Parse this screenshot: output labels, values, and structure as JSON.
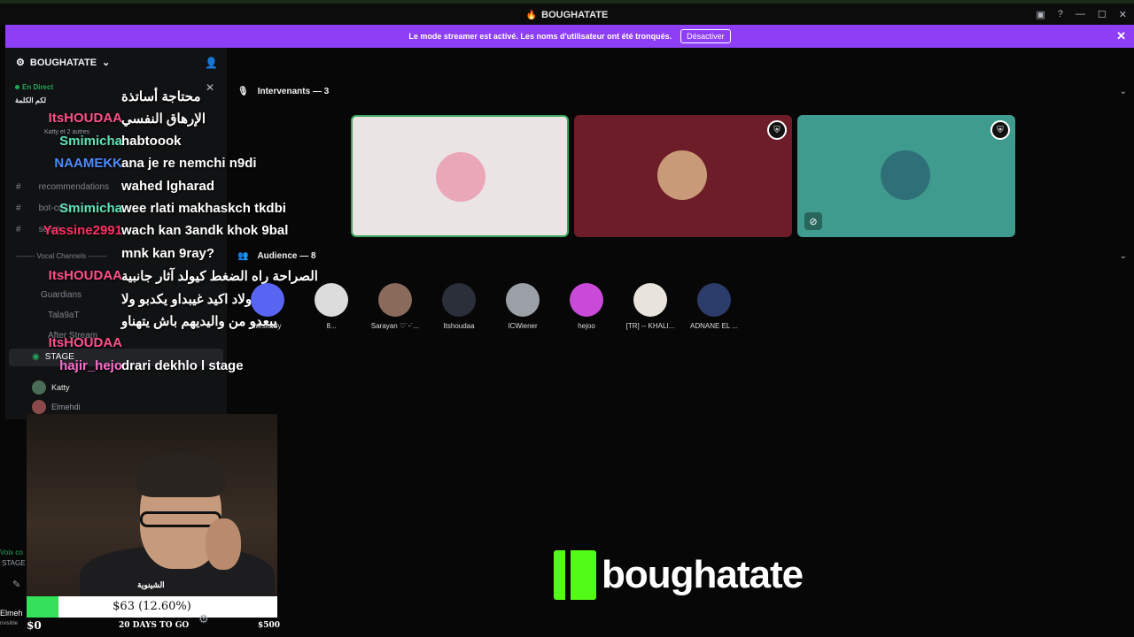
{
  "window": {
    "title": "BOUGHATATE"
  },
  "banner": {
    "text": "Le mode streamer est activé. Les noms d'utilisateur ont été tronqués.",
    "button": "Désactiver"
  },
  "sidebar": {
    "server_name": "BOUGHATATE",
    "live_label": "En Direct",
    "stage_title": "لكم الكلمة",
    "stage_subtitle": "Katty et 2 autres",
    "channels": [
      "recommendations",
      "bot-cmd",
      "setup"
    ],
    "section_vocal": "-------- Vocal Channels --------",
    "voice_channels": [
      "Guardians",
      "Tala9aT",
      "After Stream",
      "STAGE"
    ],
    "stage_users": [
      "Katty",
      "Elmehdi"
    ],
    "stage_counts": "00 20",
    "stage_sub_label": "لكم الكلمة"
  },
  "chat": [
    {
      "name": "",
      "msg": "محتاجة أساتذة",
      "color": "#ffffff"
    },
    {
      "name": "ItsHOUDAA",
      "msg": "الإرهاق النفسي",
      "color": "#ff4f8b"
    },
    {
      "name": "Smimicha",
      "msg": "habtoook",
      "color": "#5fe3b8"
    },
    {
      "name": "NAAMEKK",
      "msg": "ana je re nemchi n9di",
      "color": "#4f8bff"
    },
    {
      "name": "",
      "msg": "wahed lgharad",
      "color": "#ffffff"
    },
    {
      "name": "Smimicha",
      "msg": "wee rlati makhaskch tkdbi",
      "color": "#5fe3b8"
    },
    {
      "name": "Yassine2991",
      "msg": "wach kan 3andk khok 9bal",
      "color": "#ff2e63"
    },
    {
      "name": "",
      "msg": "mnk kan 9ray?",
      "color": "#ffffff"
    },
    {
      "name": "ItsHOUDAA",
      "msg": "الصراحة راه الضغط كيولد آثار جانبية",
      "color": "#ff4f8b"
    },
    {
      "name": "",
      "msg": "الاولاد اكيد غيبداو يكدبو ولا",
      "color": "#ffffff"
    },
    {
      "name": "",
      "msg": "يبعدو من واليديهم باش يتهناو",
      "color": "#ffffff"
    },
    {
      "name": "ItsHOUDAA",
      "msg": "",
      "color": "#ff4f8b"
    },
    {
      "name": "hajir_hejo",
      "msg": "drari dekhlo l stage",
      "color": "#ff6fcf"
    }
  ],
  "stage": {
    "speakers_label": "Intervenants — 3",
    "audience_label": "Audience — 8",
    "speakers": [
      {
        "bg": "#ebe4e4",
        "avatar_color": "#e9a7b7",
        "badge": false,
        "muted": false
      },
      {
        "bg": "#6d1d27",
        "avatar_color": "#c99a78",
        "badge": true,
        "muted": false
      },
      {
        "bg": "#3e9b8e",
        "avatar_color": "#2f6f78",
        "badge": true,
        "muted": true
      }
    ],
    "audience": [
      {
        "name": "Mrslowly",
        "color": "#5865f2"
      },
      {
        "name": "8...",
        "color": "#dcdcdc"
      },
      {
        "name": "Sarayan ♡˙ᵕ˙...",
        "color": "#8a6a5a"
      },
      {
        "name": "Itshoudaa",
        "color": "#2a2f3a"
      },
      {
        "name": "ICWiener",
        "color": "#9aa0a6"
      },
      {
        "name": "hejoo",
        "color": "#c94ad8"
      },
      {
        "name": "[TR] -- KHALI...",
        "color": "#e8e4dc"
      },
      {
        "name": "ADNANE EL ...",
        "color": "#2c3c6a"
      }
    ]
  },
  "webcam": {
    "tag": "الشينوية"
  },
  "goal": {
    "text": "$63 (12.60%)",
    "progress": 0.126,
    "min": "$0",
    "max": "$500",
    "days": "20 DAYS TO GO"
  },
  "left_stub": {
    "voice": "Voix co",
    "stage": "STAGE",
    "user": "Elmeh",
    "status": "nvisible"
  },
  "brand": {
    "logo_text": "boughatate",
    "accent": "#53fc18"
  }
}
